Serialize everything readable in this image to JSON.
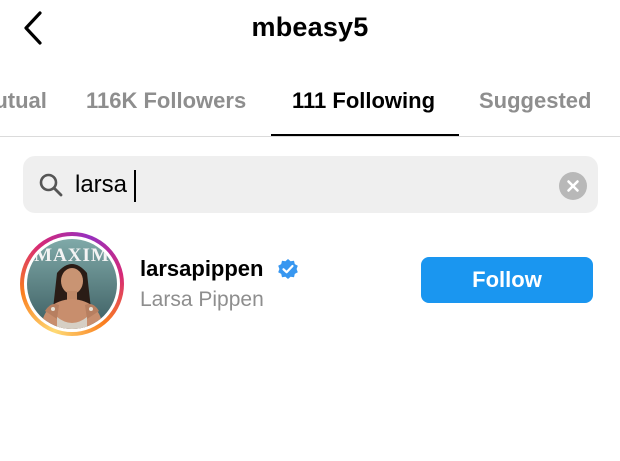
{
  "header": {
    "title": "mbeasy5",
    "back_icon": "chevron-left-icon"
  },
  "tabs": [
    {
      "label": "Mutual",
      "active": false
    },
    {
      "label": "116K Followers",
      "active": false
    },
    {
      "label": "111 Following",
      "active": true
    },
    {
      "label": "Suggested",
      "active": false
    }
  ],
  "search": {
    "value": "larsa",
    "icon": "search-icon",
    "clear_icon": "clear-icon"
  },
  "results": [
    {
      "username": "larsapippen",
      "full_name": "Larsa Pippen",
      "verified": true,
      "avatar_text": "MAXIM",
      "follow_label": "Follow"
    }
  ],
  "colors": {
    "accent_blue": "#1a96f0",
    "verified_blue": "#3897f0",
    "secondary_text": "#8e8e8e",
    "search_bg": "#efefef"
  }
}
